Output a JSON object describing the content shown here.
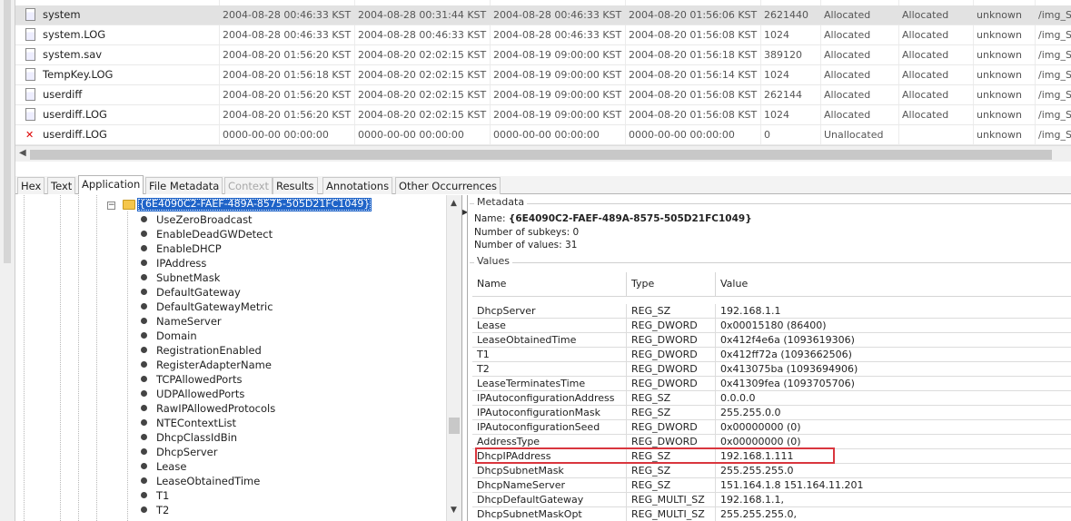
{
  "file_list": {
    "rows": [
      {
        "name": "system",
        "icon": "file-icon",
        "selected": true,
        "modified": "2004-08-28 00:46:33 KST",
        "changed": "2004-08-28 00:31:44 KST",
        "accessed": "2004-08-28 00:46:33 KST",
        "created": "2004-08-20 01:56:06 KST",
        "size": "2621440",
        "flags_dir": "Allocated",
        "flags_meta": "Allocated",
        "known": "unknown",
        "location": "/img_S"
      },
      {
        "name": "system.LOG",
        "icon": "file-icon",
        "selected": false,
        "modified": "2004-08-28 00:46:33 KST",
        "changed": "2004-08-28 00:46:33 KST",
        "accessed": "2004-08-28 00:46:33 KST",
        "created": "2004-08-20 01:56:08 KST",
        "size": "1024",
        "flags_dir": "Allocated",
        "flags_meta": "Allocated",
        "known": "unknown",
        "location": "/img_S"
      },
      {
        "name": "system.sav",
        "icon": "file-icon",
        "selected": false,
        "modified": "2004-08-20 01:56:20 KST",
        "changed": "2004-08-20 02:02:15 KST",
        "accessed": "2004-08-19 09:00:00 KST",
        "created": "2004-08-20 01:56:18 KST",
        "size": "389120",
        "flags_dir": "Allocated",
        "flags_meta": "Allocated",
        "known": "unknown",
        "location": "/img_S"
      },
      {
        "name": "TempKey.LOG",
        "icon": "file-icon",
        "selected": false,
        "modified": "2004-08-20 01:56:18 KST",
        "changed": "2004-08-20 02:02:15 KST",
        "accessed": "2004-08-19 09:00:00 KST",
        "created": "2004-08-20 01:56:14 KST",
        "size": "1024",
        "flags_dir": "Allocated",
        "flags_meta": "Allocated",
        "known": "unknown",
        "location": "/img_S"
      },
      {
        "name": "userdiff",
        "icon": "file-icon",
        "selected": false,
        "modified": "2004-08-20 01:56:20 KST",
        "changed": "2004-08-20 02:02:15 KST",
        "accessed": "2004-08-19 09:00:00 KST",
        "created": "2004-08-20 01:56:08 KST",
        "size": "262144",
        "flags_dir": "Allocated",
        "flags_meta": "Allocated",
        "known": "unknown",
        "location": "/img_S"
      },
      {
        "name": "userdiff.LOG",
        "icon": "file-icon",
        "selected": false,
        "modified": "2004-08-20 01:56:20 KST",
        "changed": "2004-08-20 02:02:15 KST",
        "accessed": "2004-08-19 09:00:00 KST",
        "created": "2004-08-20 01:56:08 KST",
        "size": "1024",
        "flags_dir": "Allocated",
        "flags_meta": "Allocated",
        "known": "unknown",
        "location": "/img_S"
      },
      {
        "name": "userdiff.LOG",
        "icon": "deleted-file-icon",
        "selected": false,
        "modified": "0000-00-00 00:00:00",
        "changed": "0000-00-00 00:00:00",
        "accessed": "0000-00-00 00:00:00",
        "created": "0000-00-00 00:00:00",
        "size": "0",
        "flags_dir": "Unallocated",
        "flags_meta": "",
        "known": "unknown",
        "location": "/img_S"
      }
    ]
  },
  "tabs": [
    {
      "label": "Hex",
      "state": "normal"
    },
    {
      "label": "Text",
      "state": "normal"
    },
    {
      "label": "Application",
      "state": "active"
    },
    {
      "label": "File Metadata",
      "state": "normal"
    },
    {
      "label": "Context",
      "state": "disabled"
    },
    {
      "label": "Results",
      "state": "normal"
    },
    {
      "label": "Annotations",
      "state": "normal"
    },
    {
      "label": "Other Occurrences",
      "state": "normal"
    }
  ],
  "tree": {
    "selected_key": "{6E4090C2-FAEF-489A-8575-505D21FC1049}",
    "children": [
      "UseZeroBroadcast",
      "EnableDeadGWDetect",
      "EnableDHCP",
      "IPAddress",
      "SubnetMask",
      "DefaultGateway",
      "DefaultGatewayMetric",
      "NameServer",
      "Domain",
      "RegistrationEnabled",
      "RegisterAdapterName",
      "TCPAllowedPorts",
      "UDPAllowedPorts",
      "RawIPAllowedProtocols",
      "NTEContextList",
      "DhcpClassIdBin",
      "DhcpServer",
      "Lease",
      "LeaseObtainedTime",
      "T1",
      "T2"
    ]
  },
  "metadata": {
    "legend": "Metadata",
    "name_label": "Name:",
    "name_value": "{6E4090C2-FAEF-489A-8575-505D21FC1049}",
    "subkeys_label": "Number of subkeys:",
    "subkeys_value": "0",
    "values_label": "Number of values:",
    "values_value": "31"
  },
  "values": {
    "legend": "Values",
    "columns": [
      "Name",
      "Type",
      "Value"
    ],
    "rows": [
      {
        "name": "DhcpServer",
        "type": "REG_SZ",
        "value": "192.168.1.1"
      },
      {
        "name": "Lease",
        "type": "REG_DWORD",
        "value": "0x00015180 (86400)"
      },
      {
        "name": "LeaseObtainedTime",
        "type": "REG_DWORD",
        "value": "0x412f4e6a (1093619306)"
      },
      {
        "name": "T1",
        "type": "REG_DWORD",
        "value": "0x412ff72a (1093662506)"
      },
      {
        "name": "T2",
        "type": "REG_DWORD",
        "value": "0x413075ba (1093694906)"
      },
      {
        "name": "LeaseTerminatesTime",
        "type": "REG_DWORD",
        "value": "0x41309fea (1093705706)"
      },
      {
        "name": "IPAutoconfigurationAddress",
        "type": "REG_SZ",
        "value": "0.0.0.0"
      },
      {
        "name": "IPAutoconfigurationMask",
        "type": "REG_SZ",
        "value": "255.255.0.0"
      },
      {
        "name": "IPAutoconfigurationSeed",
        "type": "REG_DWORD",
        "value": "0x00000000 (0)"
      },
      {
        "name": "AddressType",
        "type": "REG_DWORD",
        "value": "0x00000000 (0)"
      },
      {
        "name": "DhcpIPAddress",
        "type": "REG_SZ",
        "value": "192.168.1.111",
        "highlighted": true
      },
      {
        "name": "DhcpSubnetMask",
        "type": "REG_SZ",
        "value": "255.255.255.0"
      },
      {
        "name": "DhcpNameServer",
        "type": "REG_SZ",
        "value": "151.164.1.8 151.164.11.201"
      },
      {
        "name": "DhcpDefaultGateway",
        "type": "REG_MULTI_SZ",
        "value": "192.168.1.1,"
      },
      {
        "name": "DhcpSubnetMaskOpt",
        "type": "REG_MULTI_SZ",
        "value": "255.255.255.0,"
      }
    ]
  },
  "colors": {
    "selection": "#1e63c8",
    "highlight_box": "#d9363e",
    "deleted_icon": "#dd0000"
  }
}
